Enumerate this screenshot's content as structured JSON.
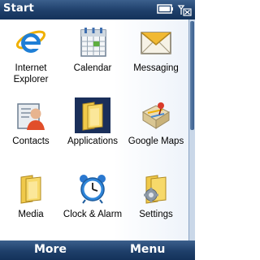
{
  "titlebar": {
    "title": "Start",
    "icons": [
      "battery-icon",
      "signal-off-icon"
    ]
  },
  "apps": [
    {
      "label_line1": "Internet",
      "label_line2": "Explorer",
      "icon": "internet-explorer-icon"
    },
    {
      "label_line1": "Calendar",
      "label_line2": "",
      "icon": "calendar-icon"
    },
    {
      "label_line1": "Messaging",
      "label_line2": "",
      "icon": "messaging-envelope-icon"
    },
    {
      "label_line1": "Contacts",
      "label_line2": "",
      "icon": "contacts-card-icon"
    },
    {
      "label_line1": "Applications",
      "label_line2": "",
      "icon": "applications-folder-icon",
      "selected": true
    },
    {
      "label_line1": "Google Maps",
      "label_line2": "",
      "icon": "google-maps-icon"
    },
    {
      "label_line1": "Media",
      "label_line2": "",
      "icon": "media-folder-icon"
    },
    {
      "label_line1": "Clock & Alarm",
      "label_line2": "",
      "icon": "alarm-clock-icon"
    },
    {
      "label_line1": "Settings",
      "label_line2": "",
      "icon": "settings-folder-icon"
    }
  ],
  "softkeys": {
    "left": "More",
    "right": "Menu"
  },
  "colors": {
    "bar": "#1e3f6a",
    "selection": "#1a2f5a",
    "scroll_track": "#c9d7e8"
  }
}
